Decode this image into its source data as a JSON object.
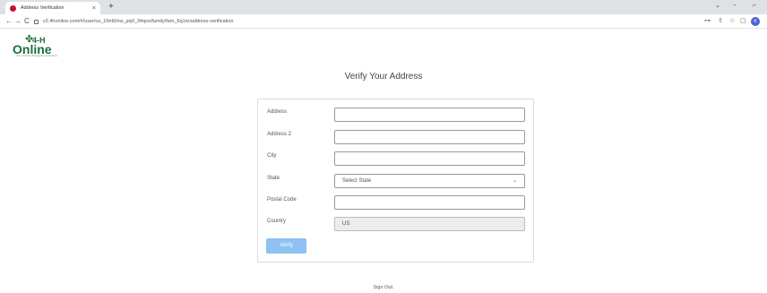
{
  "browser": {
    "tab_title": "Address Verification",
    "tab_close": "×",
    "new_tab": "+",
    "back": "←",
    "forward": "→",
    "reload": "C",
    "url": "v2.4honline.com/#/user/us_10nt6/ins_p/pf_34qos/family/fam_6q1m/address-verification",
    "minimize": "−",
    "chevron": "⌄",
    "restore": "⌐",
    "key_icon": "⊶",
    "share_icon": "⇪",
    "star_icon": "☆",
    "sidebar_icon": "▢",
    "profile_initial": "K"
  },
  "logo": {
    "top": "4-H",
    "bottom": "Online",
    "clover": "✤",
    "tagline": "A 4-H Online Management System"
  },
  "page": {
    "title": "Verify Your Address",
    "sign_out": "Sign Out."
  },
  "form": {
    "address_label": "Address",
    "address_value": "",
    "address2_label": "Address 2",
    "address2_value": "",
    "city_label": "City",
    "city_value": "",
    "state_label": "State",
    "state_value": "Select State",
    "state_chevron": "⌄",
    "postal_label": "Postal Code",
    "postal_value": "",
    "country_label": "Country",
    "country_value": "US",
    "verify_label": "Verify"
  },
  "colors": {
    "verify_button": "#8fc1f2",
    "logo_green": "#1a6e3a",
    "favicon": "#c8102e"
  }
}
